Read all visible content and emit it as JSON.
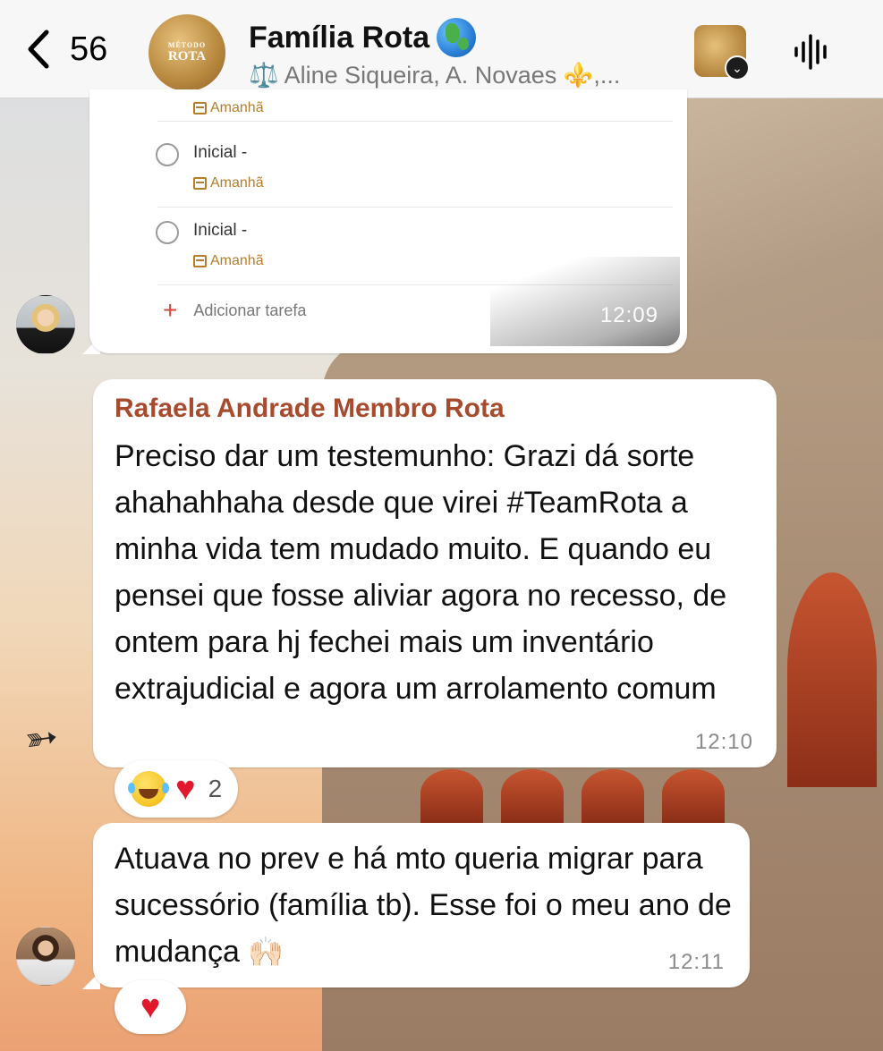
{
  "header": {
    "back_count": "56",
    "group_name": "Família Rota",
    "members": "⚖️ Aline Siqueira, A. Novaes ⚜️,...",
    "group_avatar_text_top": "MÉTODO",
    "group_avatar_text_bottom": "ROTA"
  },
  "task_screenshot": {
    "tasks": [
      {
        "title": "Inicial -",
        "date": "Amanhã"
      },
      {
        "title": "Inicial -",
        "date": "Amanhã"
      }
    ],
    "top_partial_date": "Amanhã",
    "add_task_label": "Adicionar tarefa",
    "time": "12:09"
  },
  "messages": [
    {
      "sender": "Rafaela Andrade Membro Rota",
      "text": "Preciso dar um testemunho: Grazi dá sorte ahahahhaha desde que virei #TeamRota a minha vida tem mudado muito. E quando eu pensei que fosse aliviar agora no recesso, de ontem para hj fechei mais um inventário extrajudicial e agora um arrolamento comum",
      "time": "12:10",
      "reactions": {
        "emojis": [
          "😂",
          "❤️"
        ],
        "count": "2"
      }
    },
    {
      "text": "Atuava no prev e há mto queria migrar para sucessório (família tb). Esse foi o meu ano de mudança",
      "emoji_suffix": "🙌🏻",
      "time": "12:11",
      "reactions": {
        "emojis": [
          "❤️"
        ]
      }
    }
  ],
  "colors": {
    "sender": "#a84a2d",
    "task_date": "#b57d2a",
    "add_plus": "#d0473f",
    "heart": "#e0192c"
  }
}
